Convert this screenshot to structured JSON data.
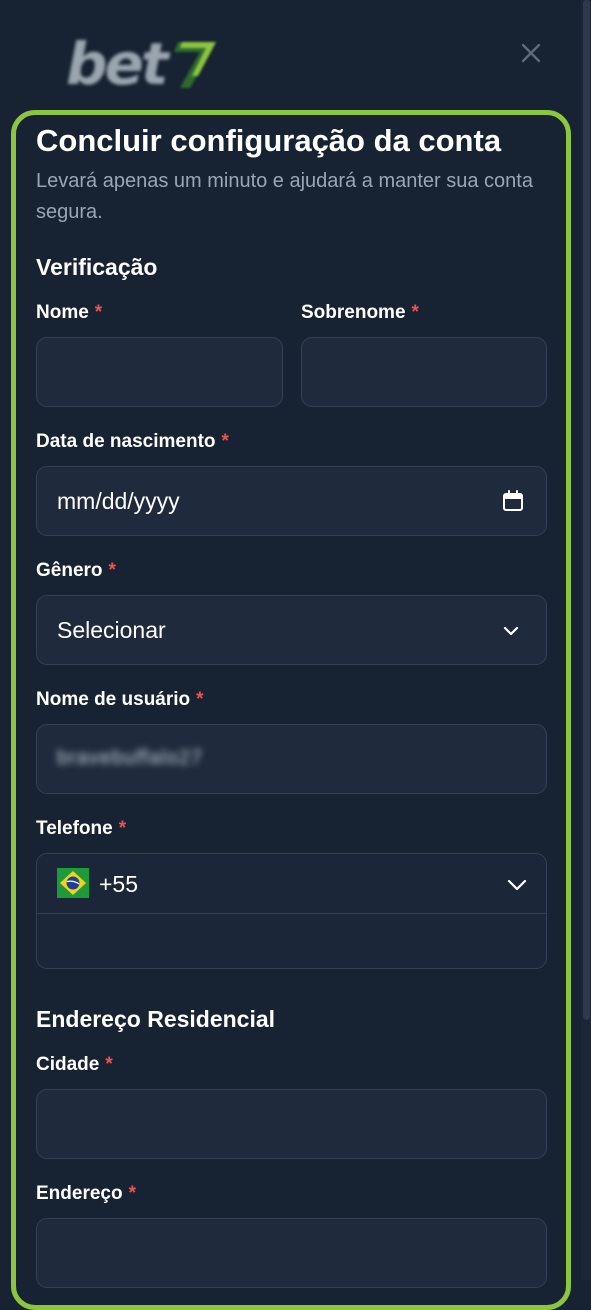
{
  "brand": {
    "logo_text": "bet",
    "logo_digit": "7",
    "accent": "#8cc63f"
  },
  "header": {
    "close_icon": "close-icon"
  },
  "card": {
    "title": "Concluir configuração da conta",
    "subtitle": "Levará apenas um minuto e ajudará a manter sua conta segura."
  },
  "verification": {
    "section_title": "Verificação",
    "first_name": {
      "label": "Nome",
      "required": "*",
      "value": ""
    },
    "last_name": {
      "label": "Sobrenome",
      "required": "*",
      "value": ""
    },
    "birth_date": {
      "label": "Data de nascimento",
      "required": "*",
      "placeholder": "mm/dd/yyyy"
    },
    "gender": {
      "label": "Gênero",
      "required": "*",
      "placeholder": "Selecionar"
    },
    "username": {
      "label": "Nome de usuário",
      "required": "*",
      "value": "bravebuffalo27"
    },
    "phone": {
      "label": "Telefone",
      "required": "*",
      "country_code": "+55",
      "flag": "brazil-flag-icon",
      "value": ""
    }
  },
  "address": {
    "section_title": "Endereço Residencial",
    "city": {
      "label": "Cidade",
      "required": "*",
      "value": ""
    },
    "street": {
      "label": "Endereço",
      "required": "*",
      "value": ""
    }
  },
  "colors": {
    "background": "#172232",
    "field_background": "#1f2b3c",
    "field_border": "#334155",
    "required": "#f05252",
    "muted_text": "#9aa6b4"
  }
}
